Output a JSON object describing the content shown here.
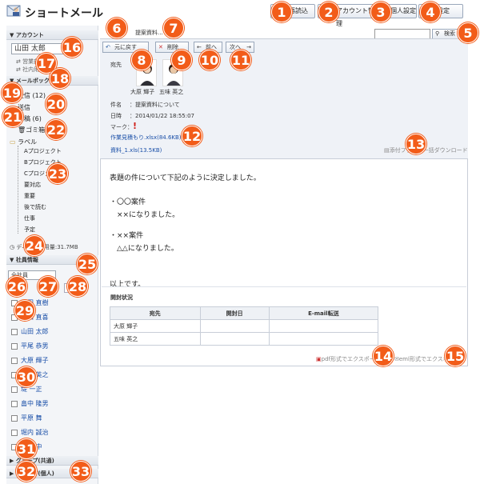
{
  "app": {
    "title": "ショートメール"
  },
  "toolbar": {
    "reload": "再読込",
    "account_mgmt": "アカウント管理",
    "personal_settings": "個人設定",
    "settings": "設定"
  },
  "tabs": {
    "active": "",
    "item": "提案資料..."
  },
  "search": {
    "button": "検索",
    "value": ""
  },
  "sidebar": {
    "account_header": "アカウント",
    "account_value": "山田 太郎",
    "account_links": [
      "営業部",
      "社内用"
    ],
    "mailbox_header": "メールボックス",
    "mailboxes": [
      "受信 (12)",
      "送信",
      "草稿 (6)",
      "ゴミ箱",
      "ラベル"
    ],
    "labels": [
      "Aプロジェクト",
      "Bプロジェクト",
      "Cプロジェクト",
      "要対応",
      "重要",
      "後で読む",
      "仕事",
      "予定"
    ],
    "disk": "ディスク使用量:31.7MB",
    "employee_header": "社員情報",
    "employee_filter": "全社員",
    "employees": [
      "平田 直樹",
      "永田 直喜",
      "山田 太郎",
      "平尾 恭男",
      "大原 輝子",
      "五味 英之",
      "堤 一正",
      "畠中 隆男",
      "平原 舞",
      "堀内 誠治",
      "細井 中"
    ],
    "groups": [
      "グループ(共通)",
      "グループ(個人)"
    ]
  },
  "message_toolbar": {
    "back": "元に戻す",
    "delete": "削除",
    "prev": "前へ",
    "next": "次へ"
  },
  "message": {
    "to_label": "宛先",
    "recipients": [
      "大原 輝子",
      "五味 英之"
    ],
    "subject_label": "件名",
    "subject": "：提案資料について",
    "date_label": "日時",
    "date": "：2014/01/22 18:55:07",
    "mark_label": "マーク：",
    "attachments": [
      "作業見積もり.xlsx(84.6KB)",
      "資料_1.xls(13.5KB)"
    ],
    "download_all": "添付ファイル一括ダウンロード",
    "body_lines": [
      "表題の件について下記のように決定しました。",
      "",
      "・〇〇案件",
      "　××になりました。",
      "",
      "・××案件",
      "　△△になりました。",
      "",
      "",
      "以上です。"
    ]
  },
  "read_status": {
    "title": "開封状況",
    "columns": [
      "宛先",
      "開封日",
      "E-mail転送"
    ],
    "rows": [
      [
        "大原 輝子",
        "",
        ""
      ],
      [
        "五味 英之",
        "",
        ""
      ]
    ]
  },
  "export": {
    "pdf": "pdf形式でエクスポート",
    "eml": "eml形式でエクスポート"
  },
  "markers": [
    "1",
    "2",
    "3",
    "4",
    "5",
    "6",
    "7",
    "8",
    "9",
    "10",
    "11",
    "12",
    "13",
    "14",
    "15",
    "16",
    "17",
    "18",
    "19",
    "20",
    "21",
    "22",
    "23",
    "24",
    "25",
    "26",
    "27",
    "28",
    "29",
    "30",
    "31",
    "32",
    "33"
  ],
  "colors": {
    "marker": "#f25c19",
    "link": "#1a4fa8",
    "mark_red": "#d0201a"
  }
}
